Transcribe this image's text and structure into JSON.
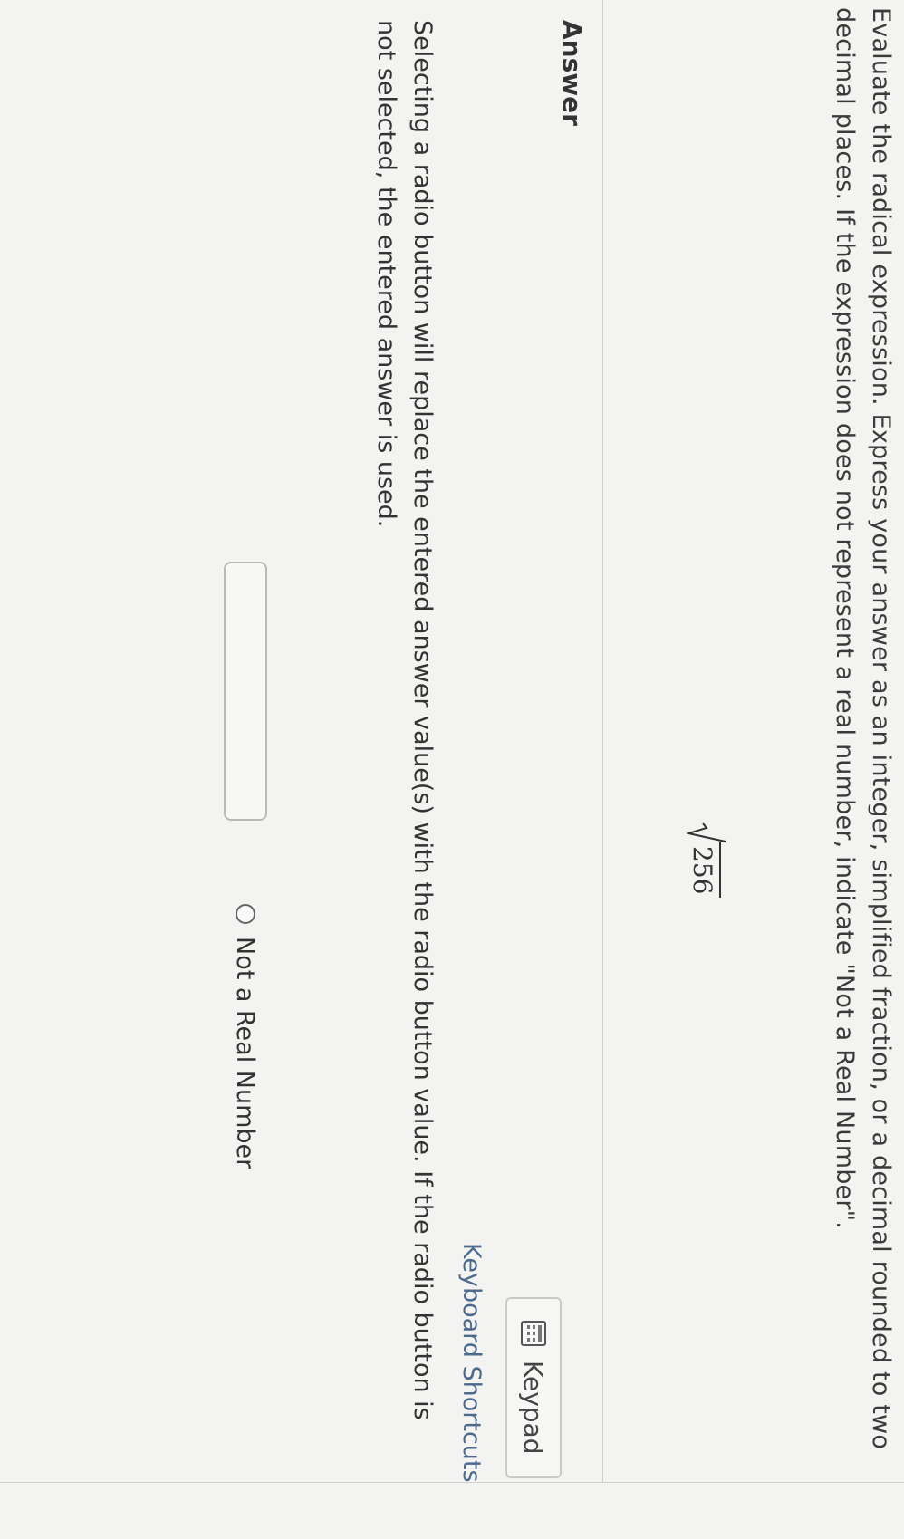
{
  "question": {
    "text": "Evaluate the radical expression. Express your answer as an integer, simplified fraction, or a decimal rounded to two decimal places. If the expression does not represent a real number, indicate \"Not a Real Number\".",
    "radicand": "256",
    "radical_icon": "square-root-symbol"
  },
  "answer": {
    "heading": "Answer",
    "keypad_label": "Keypad",
    "keypad_icon": "keypad-grid-icon",
    "shortcuts_label": "Keyboard Shortcuts",
    "instruction": "Selecting a radio button will replace the entered answer value(s) with the radio button value. If the radio button is not selected, the entered answer is used.",
    "input_value": "",
    "input_placeholder": "",
    "radio_label": "Not a Real Number",
    "radio_selected": false
  },
  "colors": {
    "link": "#4c6a8c",
    "text": "#333333",
    "background": "#f3f3f1"
  }
}
